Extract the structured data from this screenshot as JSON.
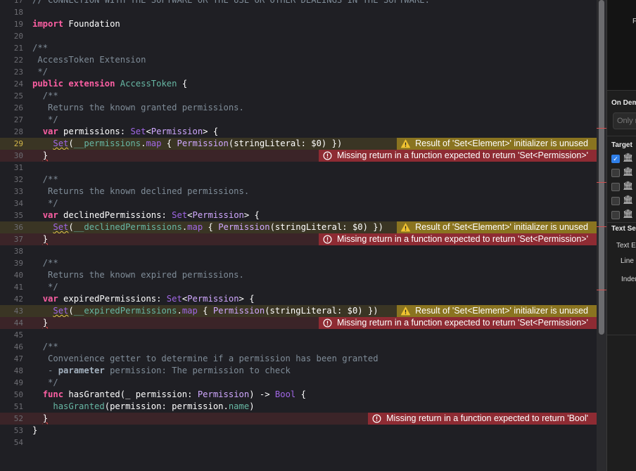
{
  "lines": [
    {
      "n": "17",
      "type": "normal",
      "tokens": [
        [
          "cm",
          "// CONNECTION WITH THE SOFTWARE OR THE USE OR OTHER DEALINGS IN THE SOFTWARE."
        ]
      ]
    },
    {
      "n": "18",
      "type": "normal",
      "tokens": []
    },
    {
      "n": "19",
      "type": "normal",
      "tokens": [
        [
          "kw",
          "import"
        ],
        [
          "pl",
          " Foundation"
        ]
      ]
    },
    {
      "n": "20",
      "type": "normal",
      "tokens": []
    },
    {
      "n": "21",
      "type": "normal",
      "tokens": [
        [
          "cm",
          "/**"
        ]
      ]
    },
    {
      "n": "22",
      "type": "normal",
      "tokens": [
        [
          "cm",
          " AccessToken Extension"
        ]
      ]
    },
    {
      "n": "23",
      "type": "normal",
      "tokens": [
        [
          "cm",
          " */"
        ]
      ]
    },
    {
      "n": "24",
      "type": "normal",
      "tokens": [
        [
          "kw",
          "public"
        ],
        [
          "pl",
          " "
        ],
        [
          "kw",
          "extension"
        ],
        [
          "pl",
          " "
        ],
        [
          "fn",
          "AccessToken"
        ],
        [
          "pl",
          " {"
        ]
      ]
    },
    {
      "n": "25",
      "type": "normal",
      "tokens": [
        [
          "cm",
          "  /**"
        ]
      ]
    },
    {
      "n": "26",
      "type": "normal",
      "tokens": [
        [
          "cm",
          "   Returns the known granted permissions."
        ]
      ]
    },
    {
      "n": "27",
      "type": "normal",
      "tokens": [
        [
          "cm",
          "   */"
        ]
      ]
    },
    {
      "n": "28",
      "type": "normal",
      "tokens": [
        [
          "pl",
          "  "
        ],
        [
          "kw",
          "var"
        ],
        [
          "pl",
          " permissions: "
        ],
        [
          "ty2",
          "Set"
        ],
        [
          "pl",
          "<"
        ],
        [
          "ty",
          "Permission"
        ],
        [
          "pl",
          "> {"
        ]
      ]
    },
    {
      "n": "29",
      "type": "warn",
      "cur": true,
      "tokens": [
        [
          "pl",
          "    "
        ],
        [
          "ty2 squig",
          "Set"
        ],
        [
          "pl",
          "("
        ],
        [
          "prop",
          "__permissions"
        ],
        [
          "pl",
          "."
        ],
        [
          "ty2",
          "map"
        ],
        [
          "pl",
          " { "
        ],
        [
          "ty",
          "Permission"
        ],
        [
          "pl",
          "(stringLiteral: $0) })"
        ]
      ]
    },
    {
      "n": "30",
      "type": "err",
      "tokens": [
        [
          "pl",
          "  "
        ],
        [
          "pl squig-r",
          "}"
        ]
      ]
    },
    {
      "n": "31",
      "type": "normal",
      "tokens": []
    },
    {
      "n": "32",
      "type": "normal",
      "tokens": [
        [
          "cm",
          "  /**"
        ]
      ]
    },
    {
      "n": "33",
      "type": "normal",
      "tokens": [
        [
          "cm",
          "   Returns the known declined permissions."
        ]
      ]
    },
    {
      "n": "34",
      "type": "normal",
      "tokens": [
        [
          "cm",
          "   */"
        ]
      ]
    },
    {
      "n": "35",
      "type": "normal",
      "tokens": [
        [
          "pl",
          "  "
        ],
        [
          "kw",
          "var"
        ],
        [
          "pl",
          " declinedPermissions: "
        ],
        [
          "ty2",
          "Set"
        ],
        [
          "pl",
          "<"
        ],
        [
          "ty",
          "Permission"
        ],
        [
          "pl",
          "> {"
        ]
      ]
    },
    {
      "n": "36",
      "type": "warn",
      "tokens": [
        [
          "pl",
          "    "
        ],
        [
          "ty2 squig",
          "Set"
        ],
        [
          "pl",
          "("
        ],
        [
          "prop",
          "__declinedPermissions"
        ],
        [
          "pl",
          "."
        ],
        [
          "ty2",
          "map"
        ],
        [
          "pl",
          " { "
        ],
        [
          "ty",
          "Permission"
        ],
        [
          "pl",
          "(stringLiteral: $0) })"
        ]
      ]
    },
    {
      "n": "37",
      "type": "err",
      "tokens": [
        [
          "pl",
          "  "
        ],
        [
          "pl squig-r",
          "}"
        ]
      ]
    },
    {
      "n": "38",
      "type": "normal",
      "tokens": []
    },
    {
      "n": "39",
      "type": "normal",
      "tokens": [
        [
          "cm",
          "  /**"
        ]
      ]
    },
    {
      "n": "40",
      "type": "normal",
      "tokens": [
        [
          "cm",
          "   Returns the known expired permissions."
        ]
      ]
    },
    {
      "n": "41",
      "type": "normal",
      "tokens": [
        [
          "cm",
          "   */"
        ]
      ]
    },
    {
      "n": "42",
      "type": "normal",
      "tokens": [
        [
          "pl",
          "  "
        ],
        [
          "kw",
          "var"
        ],
        [
          "pl",
          " expiredPermissions: "
        ],
        [
          "ty2",
          "Set"
        ],
        [
          "pl",
          "<"
        ],
        [
          "ty",
          "Permission"
        ],
        [
          "pl",
          "> {"
        ]
      ]
    },
    {
      "n": "43",
      "type": "warn",
      "tokens": [
        [
          "pl",
          "    "
        ],
        [
          "ty2 squig",
          "Set"
        ],
        [
          "pl",
          "("
        ],
        [
          "prop",
          "__expiredPermissions"
        ],
        [
          "pl",
          "."
        ],
        [
          "ty2",
          "map"
        ],
        [
          "pl",
          " { "
        ],
        [
          "ty",
          "Permission"
        ],
        [
          "pl",
          "(stringLiteral: $0) })"
        ]
      ]
    },
    {
      "n": "44",
      "type": "err",
      "tokens": [
        [
          "pl",
          "  "
        ],
        [
          "pl squig-r",
          "}"
        ]
      ]
    },
    {
      "n": "45",
      "type": "normal",
      "tokens": []
    },
    {
      "n": "46",
      "type": "normal",
      "tokens": [
        [
          "cm",
          "  /**"
        ]
      ]
    },
    {
      "n": "47",
      "type": "normal",
      "tokens": [
        [
          "cm",
          "   Convenience getter to determine if a permission has been granted"
        ]
      ]
    },
    {
      "n": "48",
      "type": "normal",
      "tokens": [
        [
          "cm",
          "   - "
        ],
        [
          "cmb",
          "parameter"
        ],
        [
          "cm",
          " permission: The permission to check"
        ]
      ]
    },
    {
      "n": "49",
      "type": "normal",
      "tokens": [
        [
          "cm",
          "   */"
        ]
      ]
    },
    {
      "n": "50",
      "type": "normal",
      "tokens": [
        [
          "pl",
          "  "
        ],
        [
          "kw",
          "func"
        ],
        [
          "pl",
          " hasGranted(_ permission: "
        ],
        [
          "ty",
          "Permission"
        ],
        [
          "pl",
          ") -> "
        ],
        [
          "ty2",
          "Bool"
        ],
        [
          "pl",
          " {"
        ]
      ]
    },
    {
      "n": "51",
      "type": "normal",
      "tokens": [
        [
          "pl",
          "    "
        ],
        [
          "fn",
          "hasGranted"
        ],
        [
          "pl",
          "(permission: permission."
        ],
        [
          "prop",
          "name"
        ],
        [
          "pl",
          ")"
        ]
      ]
    },
    {
      "n": "52",
      "type": "err",
      "tokens": [
        [
          "pl",
          "  "
        ],
        [
          "pl squig-r",
          "}"
        ]
      ]
    },
    {
      "n": "53",
      "type": "normal",
      "tokens": [
        [
          "pl",
          "}"
        ]
      ]
    },
    {
      "n": "54",
      "type": "normal",
      "tokens": []
    }
  ],
  "diagnostics": [
    {
      "line": "29",
      "kind": "warning",
      "icon": "warning-icon",
      "message": "Result of 'Set<Element>' initializer is unused"
    },
    {
      "line": "30",
      "kind": "error",
      "icon": "error-icon",
      "message": "Missing return in a function expected to return 'Set<Permission>'"
    },
    {
      "line": "36",
      "kind": "warning",
      "icon": "warning-icon",
      "message": "Result of 'Set<Element>' initializer is unused"
    },
    {
      "line": "37",
      "kind": "error",
      "icon": "error-icon",
      "message": "Missing return in a function expected to return 'Set<Permission>'"
    },
    {
      "line": "43",
      "kind": "warning",
      "icon": "warning-icon",
      "message": "Result of 'Set<Element>' initializer is unused"
    },
    {
      "line": "44",
      "kind": "error",
      "icon": "error-icon",
      "message": "Missing return in a function expected to return 'Set<Permission>'"
    },
    {
      "line": "52",
      "kind": "error",
      "icon": "error-icon",
      "message": "Missing return in a function expected to return 'Bool'"
    }
  ],
  "inspector": {
    "top_label": "F",
    "on_demand_header": "On Dem",
    "on_demand_placeholder": "Only r",
    "target_header": "Target",
    "targets": [
      {
        "checked": true,
        "icon": "bank-icon"
      },
      {
        "checked": false,
        "icon": "bank-icon"
      },
      {
        "checked": false,
        "icon": "bank-icon"
      },
      {
        "checked": false,
        "icon": "bank-icon"
      },
      {
        "checked": false,
        "icon": "bank-icon"
      }
    ],
    "text_settings_header": "Text Se",
    "text_encoding_label": "Text E",
    "line_endings_label": "Line",
    "indent_label": "Inden"
  },
  "colors": {
    "warning": "#8a7420",
    "error": "#8e2b33",
    "keyword": "#fc5fa3",
    "comment": "#7f8c98"
  }
}
